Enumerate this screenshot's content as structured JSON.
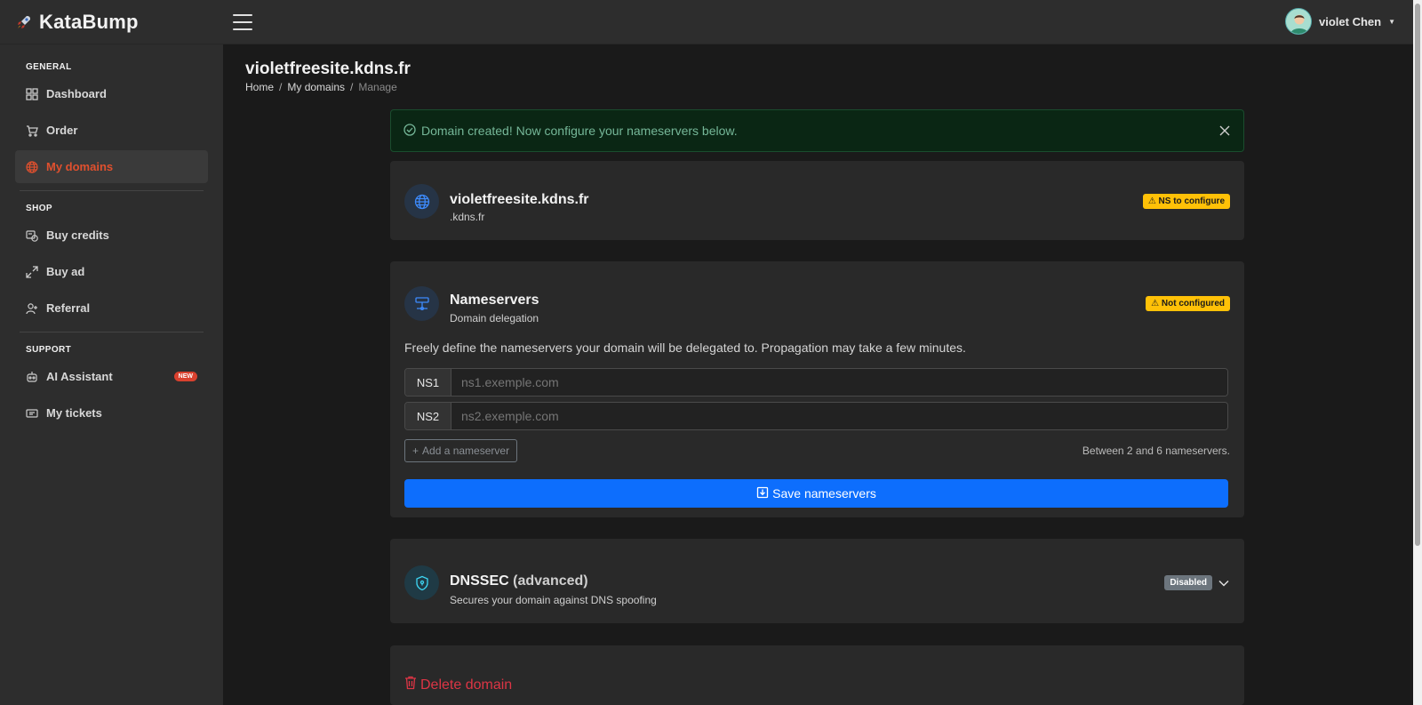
{
  "brand": {
    "name": "KataBump"
  },
  "user": {
    "name": "violet Chen"
  },
  "sidebar": {
    "sections": [
      {
        "title": "GENERAL"
      },
      {
        "title": "SHOP"
      },
      {
        "title": "SUPPORT"
      }
    ],
    "items": [
      {
        "label": "Dashboard",
        "icon": "dashboard-grid-icon"
      },
      {
        "label": "Order",
        "icon": "cart-icon"
      },
      {
        "label": "My domains",
        "icon": "globe-icon",
        "active": true
      },
      {
        "label": "Buy credits",
        "icon": "credits-icon"
      },
      {
        "label": "Buy ad",
        "icon": "expand-icon"
      },
      {
        "label": "Referral",
        "icon": "user-plus-icon"
      },
      {
        "label": "AI Assistant",
        "icon": "robot-icon",
        "badge": "NEW"
      },
      {
        "label": "My tickets",
        "icon": "ticket-icon"
      }
    ]
  },
  "page": {
    "title": "violetfreesite.kdns.fr",
    "breadcrumb": [
      "Home",
      "My domains",
      "Manage"
    ]
  },
  "alert": {
    "message": "Domain created! Now configure your nameservers below."
  },
  "domain_card": {
    "name": "violetfreesite.kdns.fr",
    "zone": ".kdns.fr",
    "status": "⚠ NS to configure"
  },
  "nameservers": {
    "title": "Nameservers",
    "subtitle": "Domain delegation",
    "status": "⚠ Not configured",
    "description": "Freely define the nameservers your domain will be delegated to. Propagation may take a few minutes.",
    "rows": [
      {
        "label": "NS1",
        "placeholder": "ns1.exemple.com"
      },
      {
        "label": "NS2",
        "placeholder": "ns2.exemple.com"
      }
    ],
    "add_label": "Add a nameserver",
    "hint": "Between 2 and 6 nameservers.",
    "save_label": "Save nameservers"
  },
  "dnssec": {
    "title": "DNSSEC",
    "title_suffix": "(advanced)",
    "subtitle": "Secures your domain against DNS spoofing",
    "status": "Disabled"
  },
  "delete": {
    "label": "Delete domain"
  },
  "colors": {
    "accent": "#0d6efd",
    "active_nav": "#e0502e",
    "warning": "#ffc107",
    "danger": "#dc3545",
    "success_text": "#75b798"
  }
}
